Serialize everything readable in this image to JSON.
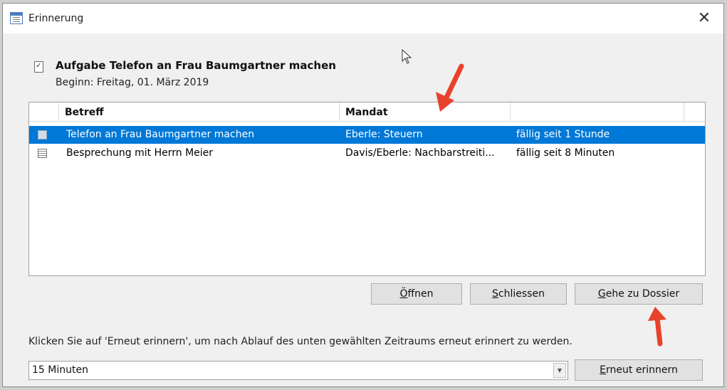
{
  "window": {
    "title": "Erinnerung",
    "close_icon": "✕"
  },
  "reminder": {
    "subject": "Aufgabe Telefon an Frau Baumgartner machen",
    "start": "Beginn: Freitag, 01. März 2019"
  },
  "list": {
    "columns": [
      "Betreff",
      "Mandat",
      ""
    ],
    "rows": [
      {
        "icon": "task-icon",
        "betreff": "Telefon an Frau Baumgartner machen",
        "mandat": "Eberle: Steuern",
        "due": "fällig seit 1 Stunde",
        "selected": true
      },
      {
        "icon": "calendar-icon",
        "betreff": "Besprechung mit Herrn Meier",
        "mandat": "Davis/Eberle: Nachbarstreiti...",
        "due": "fällig seit 8 Minuten",
        "selected": false
      }
    ]
  },
  "buttons": {
    "open": {
      "accel": "Ö",
      "rest": "ffnen"
    },
    "close": {
      "accel": "S",
      "rest": "chliessen"
    },
    "dossier": {
      "accel": "G",
      "rest": "ehe zu Dossier"
    },
    "snooze": {
      "accel": "E",
      "rest": "rneut erinnern"
    }
  },
  "snooze": {
    "hint": "Klicken Sie auf 'Erneut erinnern', um nach Ablauf des unten gewählten Zeitraums erneut erinnert zu werden.",
    "selected": "15 Minuten"
  },
  "colors": {
    "selection": "#0078d7",
    "annotation_arrow": "#e8412c"
  }
}
